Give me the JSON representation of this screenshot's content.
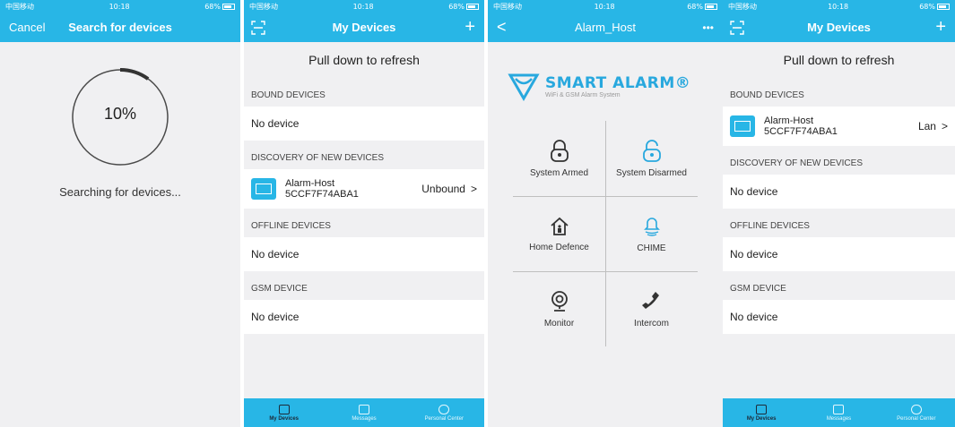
{
  "status": {
    "carrier": "中国移动",
    "time": "10:18",
    "battery": "68%"
  },
  "screen1": {
    "cancel": "Cancel",
    "title": "Search for devices",
    "progress": "10%",
    "progress_value": 0.1,
    "message": "Searching for devices..."
  },
  "screen2": {
    "title": "My Devices",
    "pull": "Pull down to refresh",
    "bound_header": "BOUND DEVICES",
    "bound_empty": "No device",
    "discovery_header": "DISCOVERY OF NEW DEVICES",
    "discovery_device": {
      "name": "Alarm-Host",
      "id": "5CCF7F74ABA1",
      "status": "Unbound"
    },
    "offline_header": "OFFLINE DEVICES",
    "offline_empty": "No device",
    "gsm_header": "GSM DEVICE",
    "gsm_empty": "No device"
  },
  "screen3": {
    "title": "Alarm_Host",
    "more": "•••",
    "logo_main": "SMART ALARM®",
    "logo_sub": "WiFi & GSM Alarm System",
    "items": [
      "System Armed",
      "System Disarmed",
      "Home Defence",
      "CHIME",
      "Monitor",
      "Intercom"
    ]
  },
  "screen4": {
    "title": "My Devices",
    "pull": "Pull down to refresh",
    "bound_header": "BOUND DEVICES",
    "bound_device": {
      "name": "Alarm-Host",
      "id": "5CCF7F74ABA1",
      "status": "Lan"
    },
    "discovery_header": "DISCOVERY OF NEW DEVICES",
    "discovery_empty": "No device",
    "offline_header": "OFFLINE DEVICES",
    "offline_empty": "No device",
    "gsm_header": "GSM DEVICE",
    "gsm_empty": "No device"
  },
  "tabs": [
    "My Devices",
    "Messages",
    "Personal Center"
  ],
  "colors": {
    "accent": "#28b6e6",
    "background": "#f0f0f2"
  },
  "icons": [
    "scan-icon",
    "add-icon",
    "back-icon",
    "more-icon",
    "lock-closed-icon",
    "lock-open-icon",
    "home-defence-icon",
    "bell-icon",
    "camera-icon",
    "phone-icon"
  ]
}
